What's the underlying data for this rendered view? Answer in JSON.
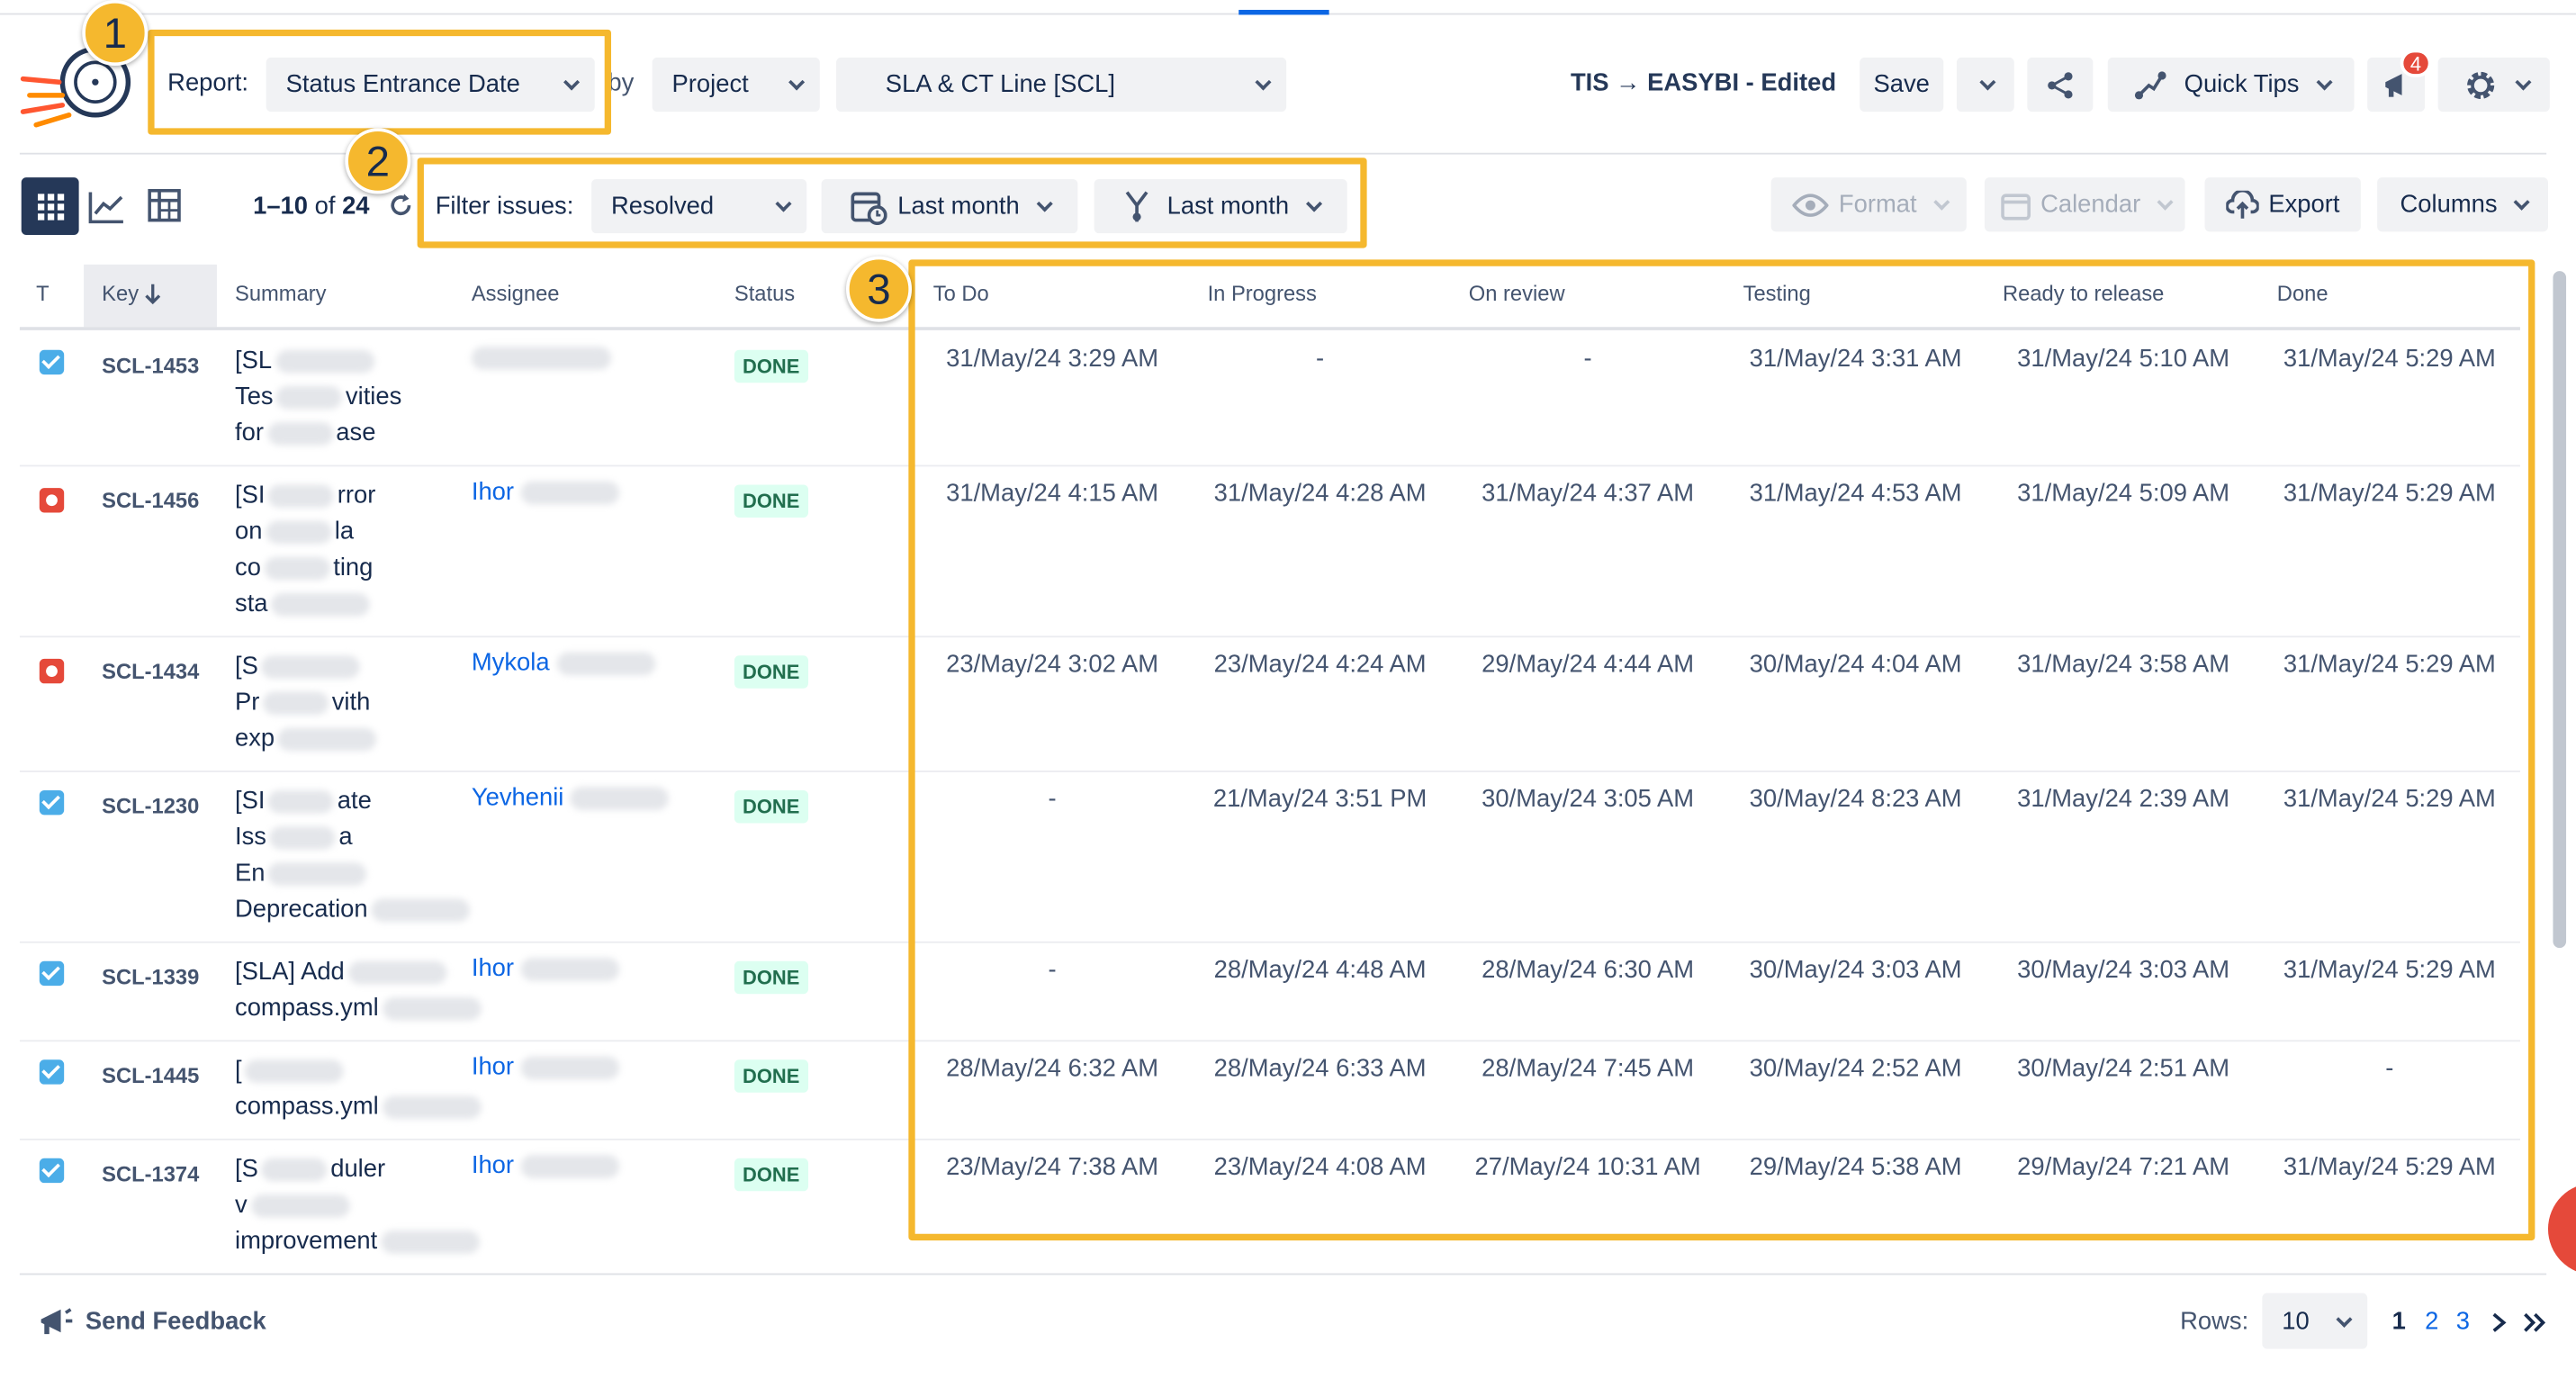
{
  "toolbar": {
    "report_label": "Report:",
    "report_value": "Status Entrance Date",
    "by_label": "by",
    "group_value": "Project",
    "project_value": "SLA & CT Line [SCL]",
    "report_name": "TIS → EASYBI - Edited",
    "save_label": "Save",
    "quick_tips_label": "Quick Tips",
    "notification_count": "4"
  },
  "filters": {
    "count_range": "1–10",
    "count_of": "of",
    "count_total": "24",
    "filter_label": "Filter issues:",
    "status_filter": "Resolved",
    "date_filter_1": "Last month",
    "date_filter_2": "Last month",
    "format_label": "Format",
    "calendar_label": "Calendar",
    "export_label": "Export",
    "columns_label": "Columns"
  },
  "markers": [
    "1",
    "2",
    "3"
  ],
  "table": {
    "headers": {
      "type": "T",
      "key": "Key",
      "summary": "Summary",
      "assignee": "Assignee",
      "status": "Status",
      "todo": "To Do",
      "inprogress": "In Progress",
      "onreview": "On review",
      "testing": "Testing",
      "ready": "Ready to release",
      "done": "Done"
    },
    "rows": [
      {
        "type": "task",
        "key": "SCL-1453",
        "summary": [
          "[SL",
          "Tes",
          "for"
        ],
        "summary_tail": [
          "",
          "vities",
          "ase"
        ],
        "assignee": "",
        "status": "DONE",
        "todo": "31/May/24 3:29 AM",
        "inprogress": "-",
        "onreview": "-",
        "testing": "31/May/24 3:31 AM",
        "ready": "31/May/24 5:10 AM",
        "done": "31/May/24 5:29 AM"
      },
      {
        "type": "bug",
        "key": "SCL-1456",
        "summary": [
          "[SI",
          "on",
          "co",
          "sta"
        ],
        "summary_tail": [
          "rror",
          "la",
          "ting",
          ""
        ],
        "assignee": "Ihor",
        "status": "DONE",
        "todo": "31/May/24 4:15 AM",
        "inprogress": "31/May/24 4:28 AM",
        "onreview": "31/May/24 4:37 AM",
        "testing": "31/May/24 4:53 AM",
        "ready": "31/May/24 5:09 AM",
        "done": "31/May/24 5:29 AM"
      },
      {
        "type": "bug",
        "key": "SCL-1434",
        "summary": [
          "[S",
          "Pr",
          "exp"
        ],
        "summary_tail": [
          "",
          "vith",
          ""
        ],
        "assignee": "Mykola",
        "status": "DONE",
        "todo": "23/May/24 3:02 AM",
        "inprogress": "23/May/24 4:24 AM",
        "onreview": "29/May/24 4:44 AM",
        "testing": "30/May/24 4:04 AM",
        "ready": "31/May/24 3:58 AM",
        "done": "31/May/24 5:29 AM"
      },
      {
        "type": "task",
        "key": "SCL-1230",
        "summary": [
          "[SI",
          "Iss",
          "En",
          "Deprecation"
        ],
        "summary_tail": [
          "ate",
          "a",
          "",
          ""
        ],
        "assignee": "Yevhenii",
        "status": "DONE",
        "todo": "-",
        "inprogress": "21/May/24 3:51 PM",
        "onreview": "30/May/24 3:05 AM",
        "testing": "30/May/24 8:23 AM",
        "ready": "31/May/24 2:39 AM",
        "done": "31/May/24 5:29 AM"
      },
      {
        "type": "task",
        "key": "SCL-1339",
        "summary": [
          "[SLA] Add",
          "compass.yml"
        ],
        "summary_tail": [
          "",
          ""
        ],
        "assignee": "Ihor",
        "status": "DONE",
        "todo": "-",
        "inprogress": "28/May/24 4:48 AM",
        "onreview": "28/May/24 6:30 AM",
        "testing": "30/May/24 3:03 AM",
        "ready": "30/May/24 3:03 AM",
        "done": "31/May/24 5:29 AM"
      },
      {
        "type": "task",
        "key": "SCL-1445",
        "summary": [
          "[",
          "compass.yml"
        ],
        "summary_tail": [
          "",
          ""
        ],
        "assignee": "Ihor",
        "status": "DONE",
        "todo": "28/May/24 6:32 AM",
        "inprogress": "28/May/24 6:33 AM",
        "onreview": "28/May/24 7:45 AM",
        "testing": "30/May/24 2:52 AM",
        "ready": "30/May/24 2:51 AM",
        "done": "-"
      },
      {
        "type": "task",
        "key": "SCL-1374",
        "summary": [
          "[S",
          "v",
          "improvement"
        ],
        "summary_tail": [
          "duler",
          "",
          ""
        ],
        "assignee": "Ihor",
        "status": "DONE",
        "todo": "23/May/24 7:38 AM",
        "inprogress": "23/May/24 4:08 AM",
        "onreview": "27/May/24 10:31 AM",
        "testing": "29/May/24 5:38 AM",
        "ready": "29/May/24 7:21 AM",
        "done": "31/May/24 5:29 AM"
      }
    ]
  },
  "footer": {
    "feedback_label": "Send Feedback",
    "rows_label": "Rows:",
    "rows_value": "10",
    "pages": [
      "1",
      "2",
      "3"
    ]
  },
  "colors": {
    "highlight": "#f5b82e",
    "accent": "#0c66e4",
    "done_bg": "#dcfff1",
    "done_text": "#216e4e"
  }
}
